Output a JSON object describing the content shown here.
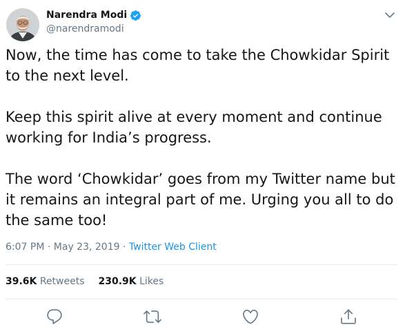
{
  "author": {
    "display_name": "Narendra Modi",
    "handle": "@narendramodi",
    "verified": true,
    "avatar": "avatar-photo"
  },
  "tweet": {
    "paragraphs": [
      "Now, the time has come to take the Chowkidar Spirit to the next level.",
      "Keep this spirit alive at every moment and continue working for India’s progress.",
      "The word ‘Chowkidar’ goes from my Twitter name but it remains an integral part of me. Urging you all to do the same too!"
    ],
    "time": "6:07 PM",
    "date": "May 23, 2019",
    "separator": "·",
    "source": "Twitter Web Client"
  },
  "stats": {
    "retweets_count": "39.6K",
    "retweets_label": "Retweets",
    "likes_count": "230.9K",
    "likes_label": "Likes"
  },
  "actions": {
    "reply": "reply-icon",
    "retweet": "retweet-icon",
    "like": "heart-icon",
    "share": "share-icon"
  },
  "colors": {
    "text": "#14171a",
    "secondary": "#657786",
    "link": "#1b95e0",
    "verified": "#1da1f2",
    "divider": "#e6ecf0"
  }
}
